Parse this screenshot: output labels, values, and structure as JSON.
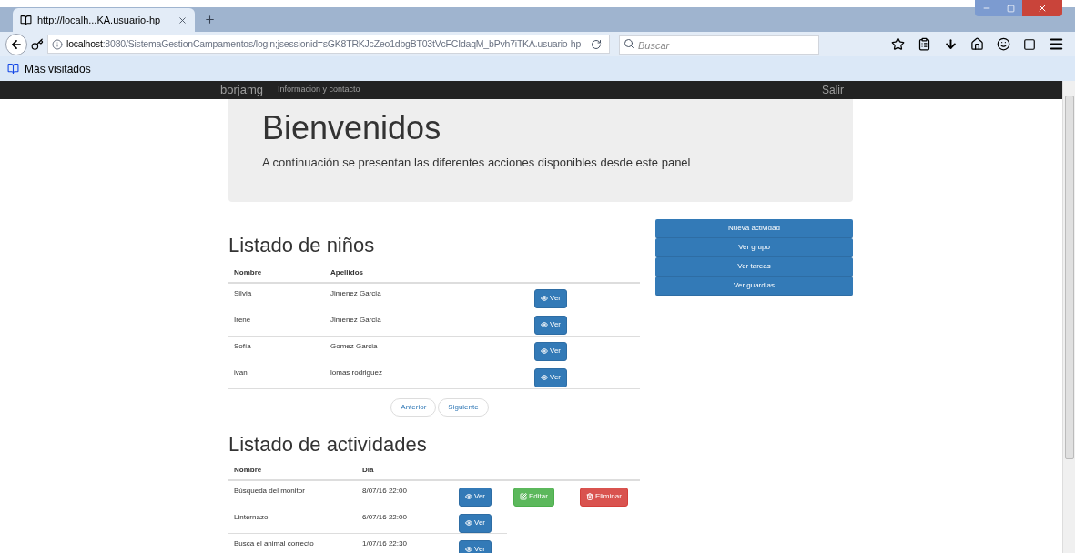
{
  "browser": {
    "tab_title": "http://localh...KA.usuario-hp",
    "url_host": "localhost",
    "url_rest": ":8080/SistemaGestionCampamentos/login;jsessionid=sGK8TRKJcZeo1dbgBT03tVcFCIdaqM_bPvh7iTKA.usuario-hp",
    "search_placeholder": "Buscar",
    "bookmark": "Más visitados"
  },
  "navbar": {
    "brand": "borjamg",
    "links": [
      "Informacion y contacto"
    ],
    "logout": "Salir"
  },
  "jumbotron": {
    "title": "Bienvenidos",
    "text": "A continuación se presentan las diferentes acciones disponibles desde este panel"
  },
  "ninos": {
    "title": "Listado de niños",
    "columns": [
      "Nombre",
      "Apellidos"
    ],
    "rows": [
      {
        "nombre": "Silvia",
        "apellidos": "Jimenez Garcia",
        "action": "Ver"
      },
      {
        "nombre": "Irene",
        "apellidos": "Jimenez Garcia",
        "action": "Ver"
      },
      {
        "nombre": "Sofía",
        "apellidos": "Gomez Garcia",
        "action": "Ver"
      },
      {
        "nombre": "ivan",
        "apellidos": "lomas rodriguez",
        "action": "Ver"
      }
    ],
    "pagination": [
      "Anterior",
      "Siguiente"
    ]
  },
  "actividades": {
    "title": "Listado de actividades",
    "columns": [
      "Nombre",
      "Dia"
    ],
    "rows": [
      {
        "nombre": "Búsqueda del monitor",
        "dia": "8/07/16 22:00",
        "actions": [
          {
            "kind": "view",
            "label": "Ver"
          },
          {
            "kind": "edit",
            "label": "Editar"
          },
          {
            "kind": "delete",
            "label": "Eliminar"
          }
        ]
      },
      {
        "nombre": "Linternazo",
        "dia": "6/07/16 22:00",
        "actions": [
          {
            "kind": "view",
            "label": "Ver"
          }
        ]
      },
      {
        "nombre": "Busca el animal correcto",
        "dia": "1/07/16 22:30",
        "actions": [
          {
            "kind": "view",
            "label": "Ver"
          }
        ]
      }
    ]
  },
  "side_buttons": [
    "Nueva actividad",
    "Ver grupo",
    "Ver tareas",
    "Ver guardias"
  ]
}
